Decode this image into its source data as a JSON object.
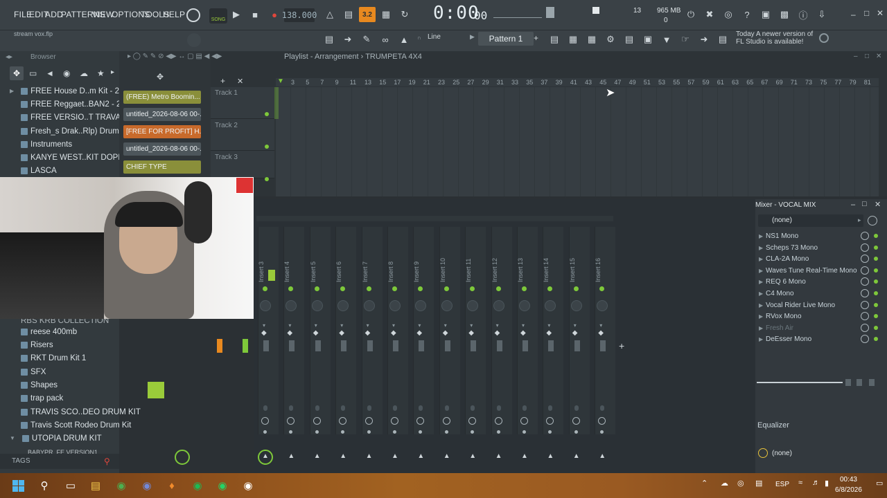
{
  "menu": [
    "FILE",
    "EDIT",
    "ADD",
    "PATTERNS",
    "VIEW",
    "OPTIONS",
    "TOOLS",
    "HELP"
  ],
  "toolbar": {
    "song_mode": "SONG",
    "bpm": "138.000",
    "snap": "3.2",
    "time": "0:00",
    "time_sub": "00",
    "cpu": "13",
    "memory": "965 MB",
    "memory_sub": "0",
    "pattern": "Pattern 1",
    "tool_line": "Line",
    "news_line1": "Today  A newer version of",
    "news_line2": "FL Studio is available!"
  },
  "hint": "stream vox.flp",
  "browser": {
    "title": "Browser",
    "items_top": [
      "FREE House D..m Kit - 2211",
      "FREE Reggaet..BAN2 - 2211",
      "FREE VERSIO..T TRAVABEATS",
      "Fresh_s Drak..Rlp) Drumkit",
      "Instruments",
      "KANYE WEST..KIT DOPEKIT",
      "LASCA"
    ],
    "items_bottom": [
      "RBS KRB COLLECTION",
      "reese 400mb",
      "Risers",
      "RKT Drum Kit 1",
      "SFX",
      "Shapes",
      "trap pack",
      "TRAVIS SCO..DEO DRUM KIT",
      "Travis Scott Rodeo Drum Kit",
      "UTOPIA DRUM KIT",
      "BABYPR_FE VERSION1"
    ],
    "tags_label": "TAGS"
  },
  "channels": [
    "(FREE) Metro Boomin...",
    "untitled_2026-08-06 00-...",
    "[FREE FOR PROFIT] H...",
    "untitled_2026-08-06 00-...",
    "CHIEF TYPE"
  ],
  "playlist": {
    "title": "Playlist - Arrangement",
    "pattern_name": "TRUMPETA 4X4",
    "ruler": [
      "3",
      "5",
      "7",
      "9",
      "11",
      "13",
      "15",
      "17",
      "19",
      "21",
      "23",
      "25",
      "27",
      "29",
      "31",
      "33",
      "35",
      "37",
      "39",
      "41",
      "43",
      "45",
      "47",
      "49",
      "51",
      "53",
      "55",
      "57",
      "59",
      "61",
      "63",
      "65",
      "67",
      "69",
      "71",
      "73",
      "75",
      "77",
      "79",
      "81"
    ],
    "tracks": [
      "Track 1",
      "Track 2",
      "Track 3"
    ]
  },
  "mixer": {
    "title": "Mixer - VOCAL MIX",
    "inserts": [
      "Insert 3",
      "Insert 4",
      "Insert 5",
      "Insert 6",
      "Insert 7",
      "Insert 8",
      "Insert 9",
      "Insert 10",
      "Insert 11",
      "Insert 12",
      "Insert 13",
      "Insert 14",
      "Insert 15",
      "Insert 16"
    ],
    "preset": "(none)",
    "fx": [
      "NS1 Mono",
      "Scheps 73 Mono",
      "CLA-2A Mono",
      "Waves Tune Real-Time Mono",
      "REQ 6 Mono",
      "C4 Mono",
      "Vocal Rider Live Mono",
      "RVox Mono",
      "Fresh Air",
      "DeEsser Mono"
    ],
    "equalizer_label": "Equalizer",
    "output": "(none)"
  },
  "taskbar": {
    "language": "ESP",
    "time": "00:43",
    "date": "6/8/2026"
  },
  "colors": {
    "accent_green": "#7ec83a",
    "channel_orange": "#c86a2b",
    "channel_olive": "#8a8f3a"
  }
}
